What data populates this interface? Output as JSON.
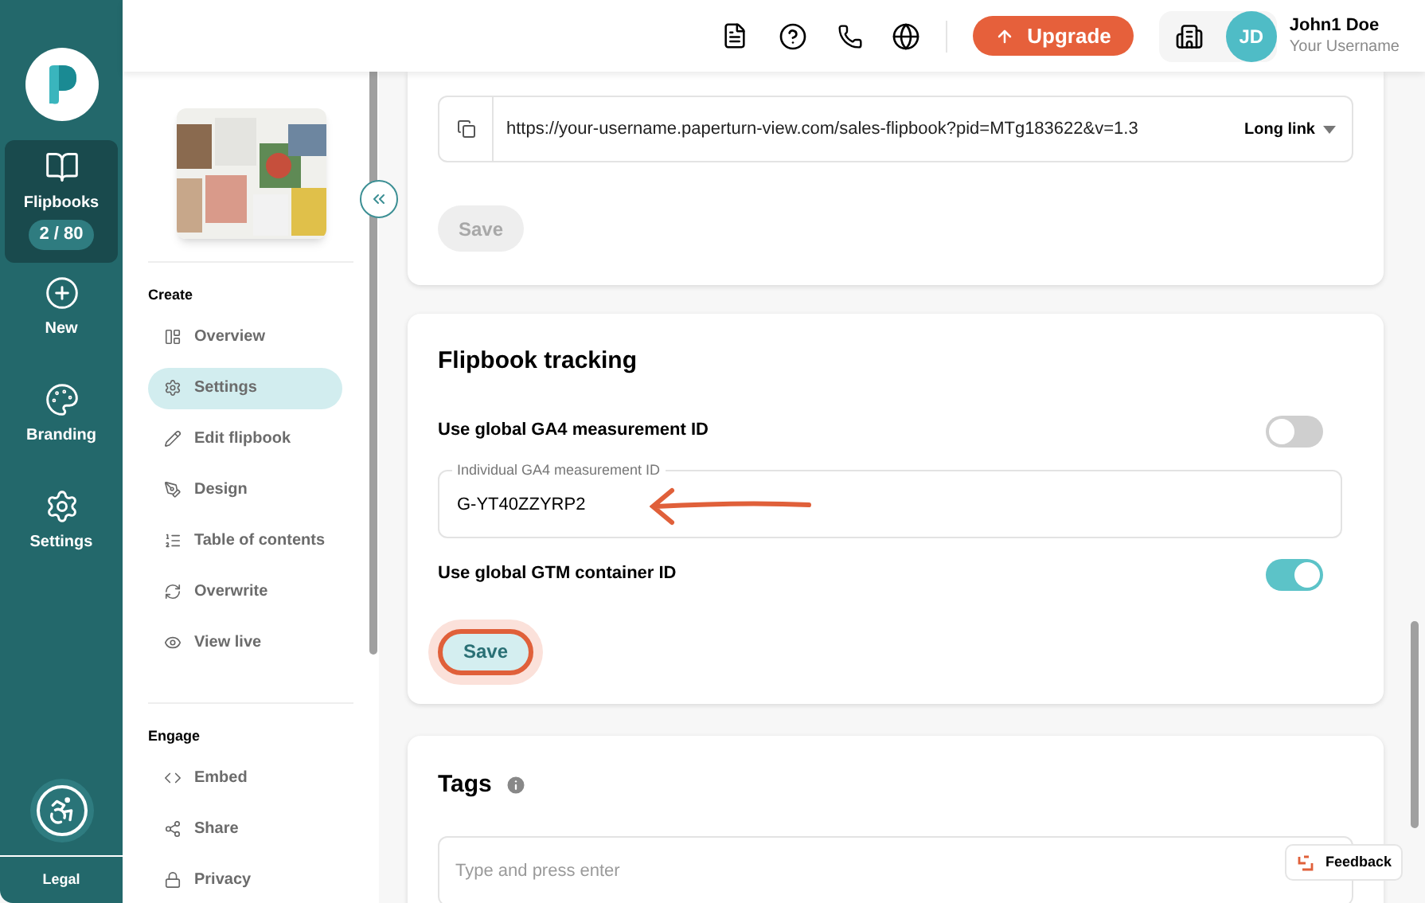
{
  "rail": {
    "items": [
      {
        "label": "Flipbooks",
        "selected": true,
        "badge": "2 / 80"
      },
      {
        "label": "New",
        "selected": false
      },
      {
        "label": "Branding",
        "selected": false
      },
      {
        "label": "Settings",
        "selected": false
      }
    ],
    "legal": "Legal"
  },
  "topbar": {
    "upgrade": "Upgrade",
    "user_initials": "JD",
    "user_name": "John1 Doe",
    "username": "Your Username"
  },
  "sidebar": {
    "sections": [
      {
        "title": "Create",
        "items": [
          {
            "label": "Overview",
            "selected": false
          },
          {
            "label": "Settings",
            "selected": true
          },
          {
            "label": "Edit flipbook",
            "selected": false
          },
          {
            "label": "Design",
            "selected": false
          },
          {
            "label": "Table of contents",
            "selected": false
          },
          {
            "label": "Overwrite",
            "selected": false
          },
          {
            "label": "View live",
            "selected": false
          }
        ]
      },
      {
        "title": "Engage",
        "items": [
          {
            "label": "Embed",
            "selected": false
          },
          {
            "label": "Share",
            "selected": false
          },
          {
            "label": "Privacy",
            "selected": false
          }
        ]
      }
    ]
  },
  "link_card": {
    "url": "https://your-username.paperturn-view.com/sales-flipbook?pid=MTg183622&v=1.3",
    "link_type": "Long link",
    "save": {
      "label": "Save",
      "disabled": true,
      "highlighted": false
    }
  },
  "tracking": {
    "title": "Flipbook tracking",
    "rows": [
      {
        "kind": "toggle",
        "label": "Use global GA4 measurement ID",
        "on": false
      },
      {
        "kind": "field",
        "label": "Individual GA4 measurement ID",
        "value": "G-YT40ZZYRP2"
      },
      {
        "kind": "toggle",
        "label": "Use global GTM container ID",
        "on": true
      }
    ],
    "save": {
      "label": "Save",
      "disabled": false,
      "highlighted": true
    }
  },
  "tags": {
    "title": "Tags",
    "placeholder": "Type and press enter"
  },
  "feedback": "Feedback"
}
